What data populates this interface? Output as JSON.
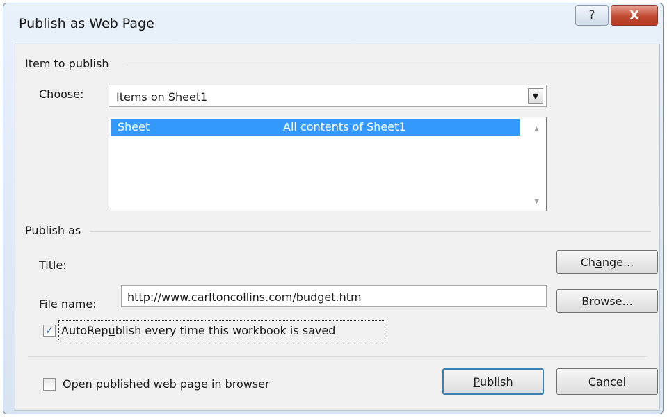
{
  "window": {
    "title": "Publish as Web Page",
    "help_icon": "question-mark",
    "close_icon": "x",
    "help_label": "?",
    "close_label": "X"
  },
  "item_to_publish": {
    "group_label": "Item to publish",
    "choose_label_accel": "C",
    "choose_label_rest": "hoose:",
    "choose_value": "Items on Sheet1",
    "items": [
      {
        "name": "Sheet",
        "description": "All contents of Sheet1",
        "selected": true
      }
    ]
  },
  "publish_as": {
    "group_label": "Publish as",
    "title_label": "Title:",
    "change_button_pre": "Ch",
    "change_button_accel": "a",
    "change_button_post": "nge...",
    "file_name_label_pre": "File ",
    "file_name_label_accel": "n",
    "file_name_label_post": "ame:",
    "file_name_value": "http://www.carltoncollins.com/budget.htm",
    "browse_button_accel": "B",
    "browse_button_post": "rowse...",
    "autorepublish_checked": true,
    "autorepublish_pre": "AutoRep",
    "autorepublish_accel": "u",
    "autorepublish_post": "blish every time this workbook is saved"
  },
  "footer": {
    "open_in_browser_checked": false,
    "open_in_browser_accel": "O",
    "open_in_browser_post": "pen published web page in browser",
    "publish_button_accel": "P",
    "publish_button_post": "ublish",
    "cancel_button": "Cancel"
  },
  "colors": {
    "selection": "#3399ff",
    "close_button": "#c24a32",
    "dialog_bg": "#f0f0f0"
  }
}
